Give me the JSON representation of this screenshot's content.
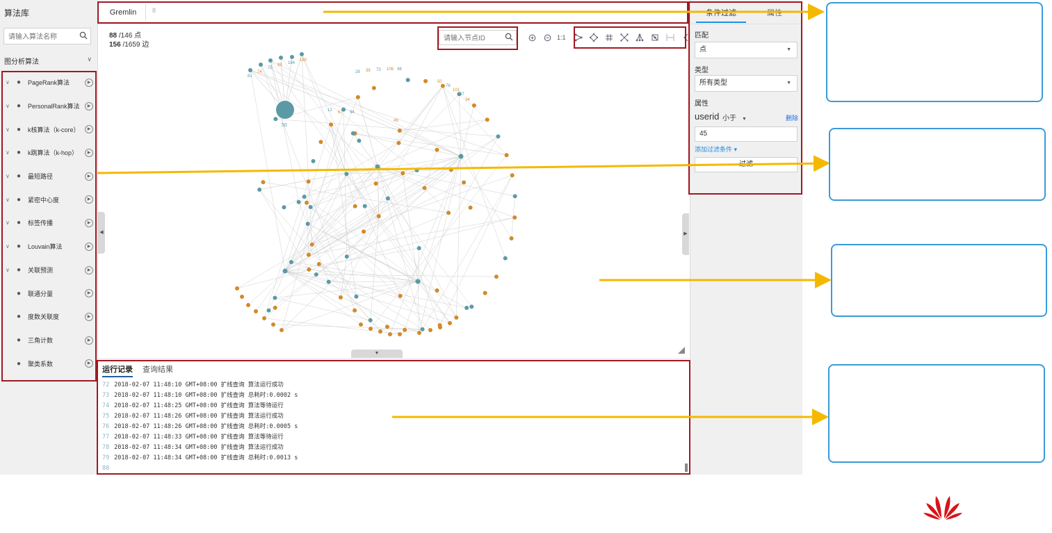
{
  "sidebar": {
    "title": "算法库",
    "search_placeholder": "请输入算法名称",
    "section_title": "图分析算法",
    "algorithms": [
      {
        "label": "PageRank算法",
        "icon": "pagerank-icon"
      },
      {
        "label": "PersonalRank算法",
        "icon": "personalrank-icon"
      },
      {
        "label": "k核算法（k-core）",
        "icon": "kcore-icon"
      },
      {
        "label": "k跳算法（k-hop）",
        "icon": "khop-icon"
      },
      {
        "label": "最短路径",
        "icon": "shortest-path-icon"
      },
      {
        "label": "紧密中心度",
        "icon": "closeness-icon"
      },
      {
        "label": "标签传播",
        "icon": "label-propagation-icon"
      },
      {
        "label": "Louvain算法",
        "icon": "louvain-icon"
      },
      {
        "label": "关联预测",
        "icon": "link-prediction-icon"
      },
      {
        "label": "联通分量",
        "icon": "connected-component-icon"
      },
      {
        "label": "度数关联度",
        "icon": "degree-correlation-icon"
      },
      {
        "label": "三角计数",
        "icon": "triangle-count-icon"
      },
      {
        "label": "聚类系数",
        "icon": "clustering-icon"
      }
    ]
  },
  "topbar": {
    "tab_label": "Gremlin",
    "tab_close": "8"
  },
  "canvas": {
    "stats_vertices_prefix": "88",
    "stats_vertices_suffix": " /146 点",
    "stats_edges_prefix": "156",
    "stats_edges_suffix": " /1659 边",
    "node_search_placeholder": "请输入节点ID",
    "zoom_ratio_label": "1:1"
  },
  "graph": {
    "node_color_blue": "#5b9aa5",
    "node_color_orange": "#d28a28",
    "edge_color": "#cfcfcf",
    "hub_label": "50",
    "labels_top": [
      "81",
      "74",
      "75",
      "98",
      "184",
      "180",
      "12",
      "67",
      "94",
      "49",
      "28",
      "38",
      "73",
      "106",
      "48",
      "50",
      "78",
      "101",
      "57",
      "34"
    ]
  },
  "logpanel": {
    "tabs": [
      "运行记录",
      "查询结果"
    ],
    "lines": [
      {
        "n": "72",
        "text": "2018-02-07 11:48:10 GMT+08:00 扩线查询 算法运行成功"
      },
      {
        "n": "73",
        "text": "2018-02-07 11:48:10 GMT+08:00 扩线查询 总耗时:0.0002 s"
      },
      {
        "n": "74",
        "text": "2018-02-07 11:48:25 GMT+08:00 扩线查询 算法等待运行"
      },
      {
        "n": "75",
        "text": "2018-02-07 11:48:26 GMT+08:00 扩线查询 算法运行成功"
      },
      {
        "n": "76",
        "text": "2018-02-07 11:48:26 GMT+08:00 扩线查询 总耗时:0.0005 s"
      },
      {
        "n": "77",
        "text": "2018-02-07 11:48:33 GMT+08:00 扩线查询 算法等待运行"
      },
      {
        "n": "78",
        "text": "2018-02-07 11:48:34 GMT+08:00 扩线查询 算法运行成功"
      },
      {
        "n": "79",
        "text": "2018-02-07 11:48:34 GMT+08:00 扩线查询 总耗时:0.0013 s"
      },
      {
        "n": "80",
        "text": ""
      }
    ]
  },
  "rpanel": {
    "tab_filter": "条件过滤",
    "tab_property": "属性",
    "match_label": "匹配",
    "match_value": "点",
    "type_label": "类型",
    "type_value": "所有类型",
    "property_label": "属性",
    "attr_name": "userid",
    "attr_operator": "小于",
    "attr_delete": "删除",
    "attr_value": "45",
    "add_condition": "添加过滤条件 ▾",
    "filter_button": "过滤"
  },
  "annotation": {
    "box_color": "#a01822",
    "arrow_color": "#f5b800",
    "callout_color": "#3a9ad9"
  }
}
